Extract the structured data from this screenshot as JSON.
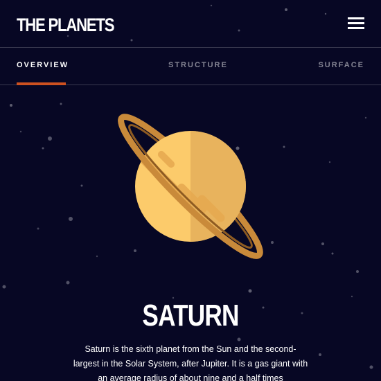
{
  "header": {
    "logo": "THE PLANETS",
    "menu_icon": "hamburger-menu-icon"
  },
  "tabs": [
    {
      "label": "OVERVIEW",
      "active": true
    },
    {
      "label": "STRUCTURE",
      "active": false
    },
    {
      "label": "SURFACE",
      "active": false
    }
  ],
  "planet": {
    "name": "SATURN",
    "image_icon": "saturn-planet-icon",
    "description": "Saturn is the sixth planet from the Sun and the second-largest in the Solar System, after Jupiter. It is a gas giant with an average radius of about nine and a half times"
  },
  "colors": {
    "background": "#070724",
    "accent": "#CD5120",
    "planet_light": "#FCCB6B",
    "planet_shade": "#E8B35D",
    "ring": "#C98A3A"
  }
}
